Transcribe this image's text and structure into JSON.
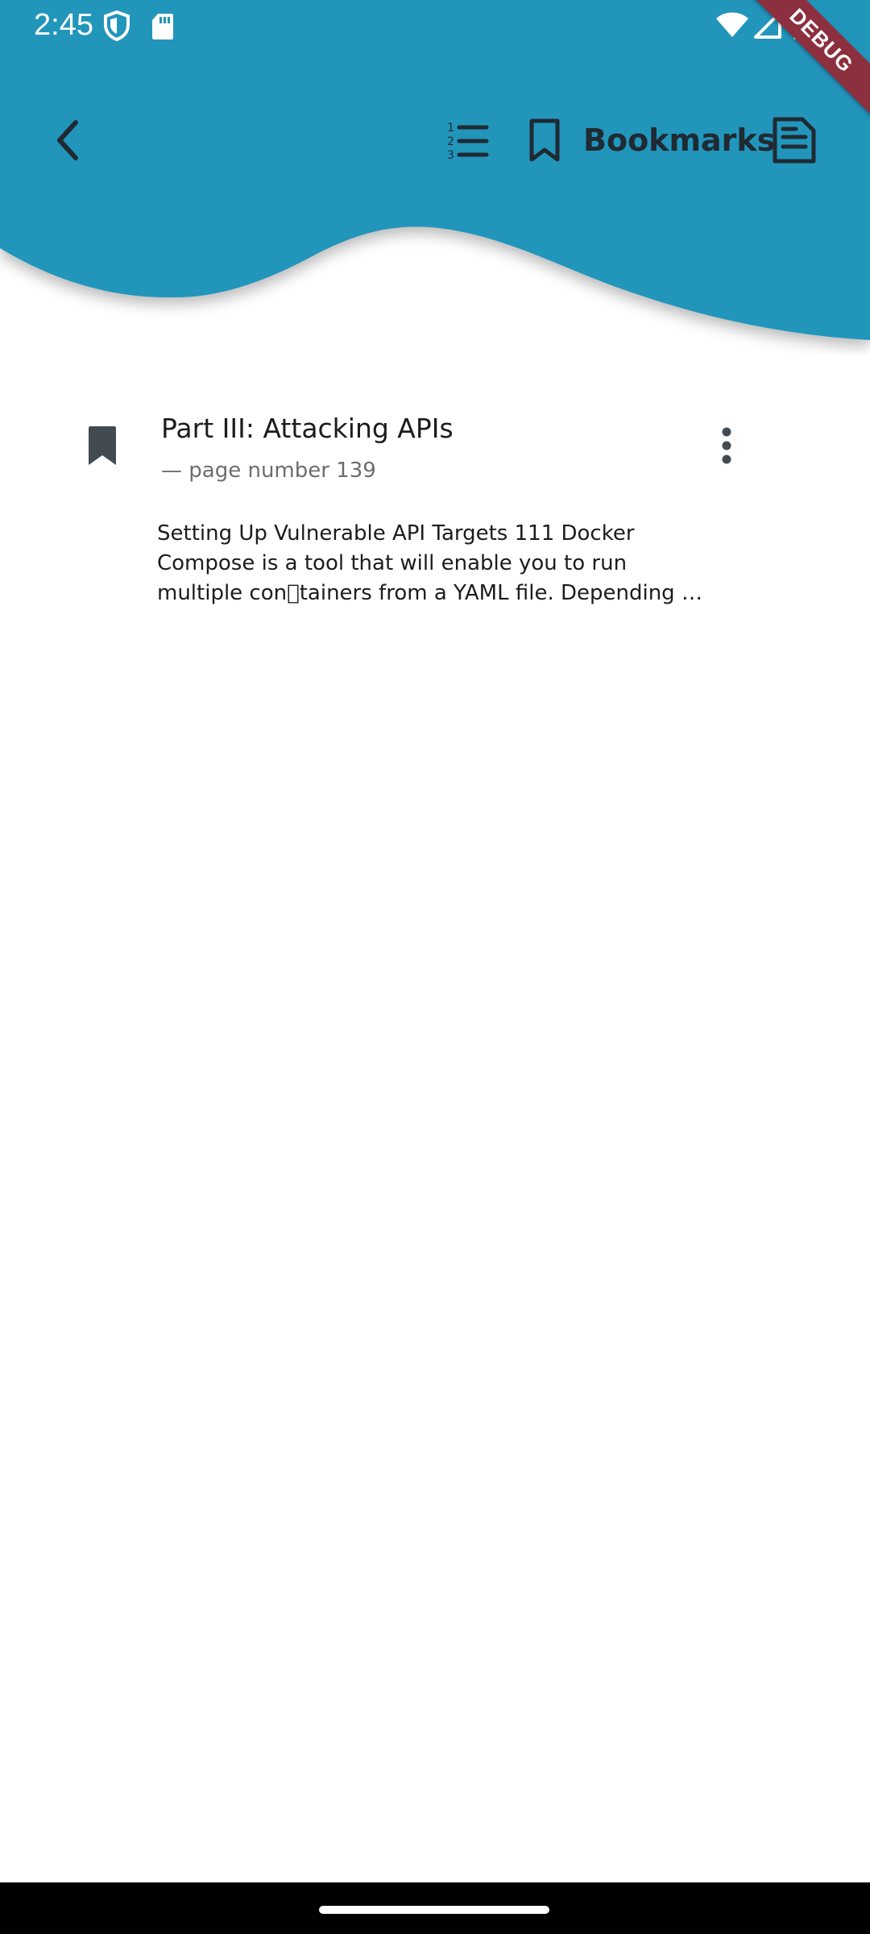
{
  "status_bar": {
    "time": "2:45",
    "icons": [
      "shield-icon",
      "sd-card-icon",
      "wifi-icon",
      "cellular-signal-icon",
      "battery-icon"
    ]
  },
  "debug_banner": {
    "label": "DEBUG"
  },
  "toolbar": {
    "back_icon": "chevron-left-icon",
    "contents_icon": "numbered-list-icon",
    "bookmarks_icon": "bookmark-outline-icon",
    "bookmarks_label": "Bookmarks",
    "notes_icon": "document-icon"
  },
  "bookmarks": [
    {
      "icon": "bookmark-filled-icon",
      "title": "Part III: Attacking APIs",
      "subtitle": "— page number 139",
      "excerpt": "Setting Up Vulnerable API Targets   111  Docker\nCompose is a tool that will enable you to run\nmultiple con\u0000tainers from a YAML file. Depending …",
      "menu_icon": "more-vertical-icon"
    }
  ],
  "colors": {
    "header": "#2195bb",
    "icon_dark": "#1f2a33",
    "bookmark_icon": "#424a52",
    "debug_ribbon": "#8c2f3f"
  }
}
